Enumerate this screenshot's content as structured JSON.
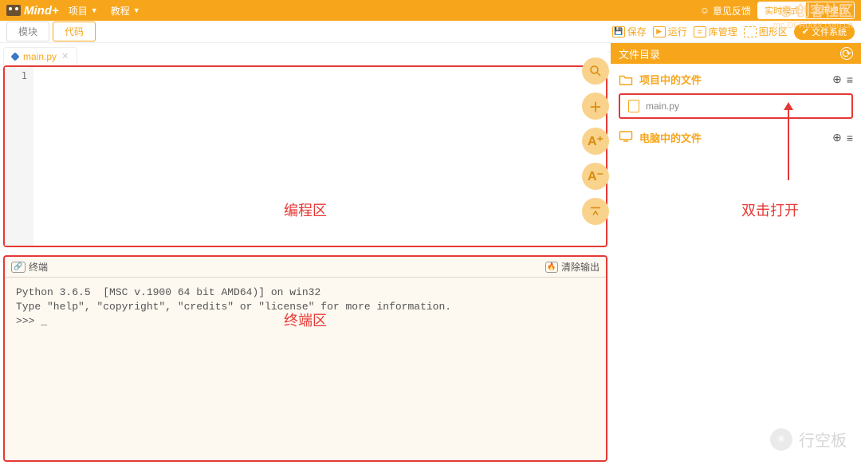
{
  "topbar": {
    "logo_text": "Mind+",
    "menu": {
      "project": "项目",
      "tutorial": "教程"
    },
    "feedback": "意见反馈",
    "mode": {
      "realtime": "实时模式",
      "upload": "上传模式"
    },
    "community": "创客社区",
    "community_url": "mc.DFRobot.com.cn"
  },
  "secondbar": {
    "tabs": {
      "blocks": "模块",
      "code": "代码"
    },
    "tools": {
      "save": "保存",
      "run": "运行",
      "lib": "库管理",
      "graph": "图形区",
      "filesys": "文件系统"
    }
  },
  "editor": {
    "tab_name": "main.py",
    "line_num": "1",
    "label": "编程区"
  },
  "terminal": {
    "title": "终端",
    "clear": "清除输出",
    "line1": "Python 3.6.5  [MSC v.1900 64 bit AMD64)] on win32",
    "line2": "Type \"help\", \"copyright\", \"credits\" or \"license\" for more information.",
    "line3": ">>> _",
    "label": "终端区"
  },
  "files": {
    "title": "文件目录",
    "section_project": "项目中的文件",
    "file_main": "main.py",
    "section_pc": "电脑中的文件",
    "dblclick_hint": "双击打开"
  },
  "watermark_bottom": "行空板"
}
